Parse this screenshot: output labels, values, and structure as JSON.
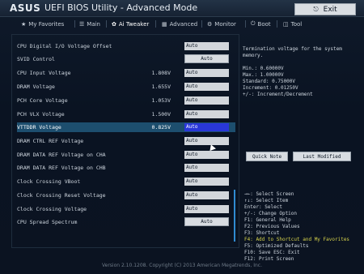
{
  "titlebar": {
    "logo": "ASUS",
    "title": "UEFI BIOS Utility - Advanced Mode",
    "exit_label": "Exit"
  },
  "tabs": [
    {
      "icon": "star-icon",
      "label": "My Favorites"
    },
    {
      "icon": "list-icon",
      "label": "Main"
    },
    {
      "icon": "tweaker-icon",
      "label": "Ai Tweaker"
    },
    {
      "icon": "advanced-icon",
      "label": "Advanced"
    },
    {
      "icon": "monitor-icon",
      "label": "Monitor"
    },
    {
      "icon": "power-icon",
      "label": "Boot"
    },
    {
      "icon": "tool-icon",
      "label": "Tool"
    }
  ],
  "rows": [
    {
      "label": "CPU Digital I/O Voltage Offset",
      "value": "",
      "control": "field",
      "setting": "Auto"
    },
    {
      "label": "SVID Control",
      "value": "",
      "control": "button",
      "setting": "Auto"
    },
    {
      "label": "CPU Input Voltage",
      "value": "1.808V",
      "control": "field",
      "setting": "Auto"
    },
    {
      "label": "DRAM Voltage",
      "value": "1.655V",
      "control": "field",
      "setting": "Auto"
    },
    {
      "label": "PCH Core Voltage",
      "value": "1.053V",
      "control": "field",
      "setting": "Auto"
    },
    {
      "label": "PCH VLX Voltage",
      "value": "1.500V",
      "control": "field",
      "setting": "Auto"
    },
    {
      "label": "VTTDDR Voltage",
      "value": "0.825V",
      "control": "field",
      "setting": "Auto",
      "selected": true
    },
    {
      "label": "DRAM CTRL REF Voltage",
      "value": "",
      "control": "field",
      "setting": "Auto"
    },
    {
      "label": "DRAM DATA REF Voltage on CHA",
      "value": "",
      "control": "field",
      "setting": "Auto"
    },
    {
      "label": "DRAM DATA REF Voltage on CHB",
      "value": "",
      "control": "field",
      "setting": "Auto"
    },
    {
      "label": "Clock Crossing VBoot",
      "value": "",
      "control": "field",
      "setting": "Auto"
    },
    {
      "label": "Clock Crossing Reset Voltage",
      "value": "",
      "control": "field",
      "setting": "Auto"
    },
    {
      "label": "Clock Crossing Voltage",
      "value": "",
      "control": "field",
      "setting": "Auto"
    },
    {
      "label": "CPU Spread Spectrum",
      "value": "",
      "control": "button",
      "setting": "Auto"
    }
  ],
  "help": {
    "lines": [
      "Termination voltage for the system",
      "memory.",
      "",
      "Min.: 0.60000V",
      "Max.: 1.00000V",
      "Standard: 0.75000V",
      "Increment: 0.01250V",
      "+/-: Increment/Decrement"
    ]
  },
  "actions": {
    "quick_note": "Quick Note",
    "last_modified": "Last Modified"
  },
  "keys": [
    {
      "text": "→←: Select Screen",
      "highlight": false
    },
    {
      "text": "↑↓: Select Item",
      "highlight": false
    },
    {
      "text": "Enter: Select",
      "highlight": false
    },
    {
      "text": "+/-: Change Option",
      "highlight": false
    },
    {
      "text": "F1: General Help",
      "highlight": false
    },
    {
      "text": "F2: Previous Values",
      "highlight": false
    },
    {
      "text": "F3: Shortcut",
      "highlight": false
    },
    {
      "text": "F4: Add to Shortcut and My Favorites",
      "highlight": true
    },
    {
      "text": "F5: Optimized Defaults",
      "highlight": false
    },
    {
      "text": "F10: Save  ESC: Exit",
      "highlight": false
    },
    {
      "text": "F12: Print Screen",
      "highlight": false
    }
  ],
  "footer": "Version 2.10.1208. Copyright (C) 2013 American Megatrends, Inc.",
  "colors": {
    "background": "#0b1220",
    "selected_row": "#1d4e6e",
    "selected_field": "#2937d8",
    "highlight_key": "#d6d24a"
  }
}
